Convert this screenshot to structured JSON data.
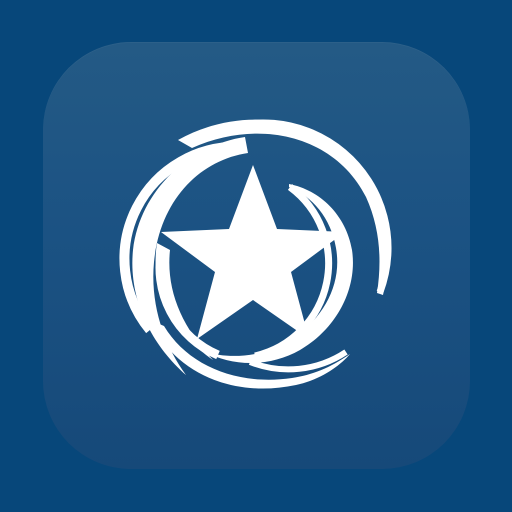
{
  "app_icon": {
    "name": "star-emblem-app-icon",
    "icon": "star-in-swirl-icon",
    "colors": {
      "background": "#07477a",
      "tile_top": "#245a85",
      "tile_bottom": "#164979",
      "emblem": "#ffffff"
    }
  }
}
